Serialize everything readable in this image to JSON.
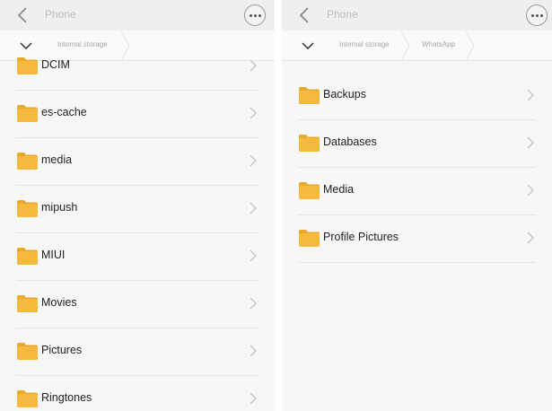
{
  "screens": [
    {
      "title": "Phone",
      "breadcrumbs": [
        "Internal storage"
      ],
      "folders": [
        "DCIM",
        "es-cache",
        "media",
        "mipush",
        "MIUI",
        "Movies",
        "Pictures",
        "Ringtones"
      ]
    },
    {
      "title": "Phone",
      "breadcrumbs": [
        "Internal storage",
        "WhatsApp"
      ],
      "folders": [
        "Backups",
        "Databases",
        "Media",
        "Profile Pictures"
      ]
    }
  ],
  "icons": {
    "back": "back-arrow-icon",
    "more": "more-options-icon",
    "collapse": "chevron-down-icon",
    "folder": "folder-icon",
    "row_chevron": "chevron-right-icon"
  },
  "colors": {
    "folder": "#F5B93E",
    "folder_tab": "#E9A92C",
    "text": "#222222",
    "muted": "#BDBDBD",
    "divider": "#E6E6E6"
  }
}
